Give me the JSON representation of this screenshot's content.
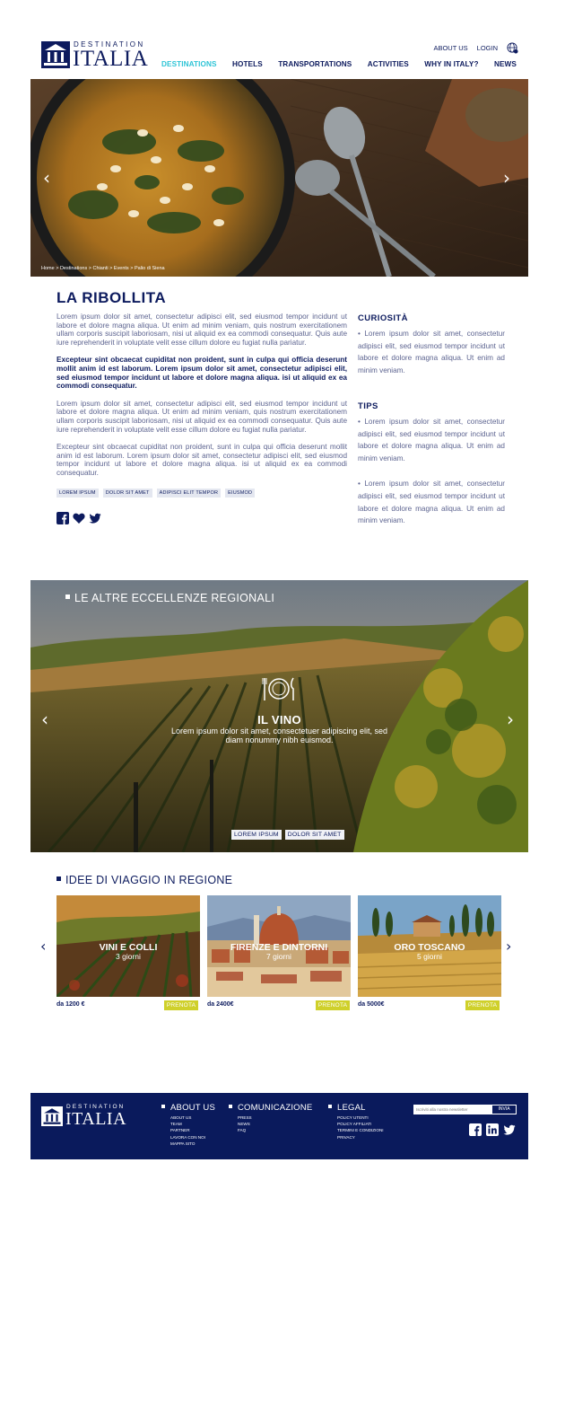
{
  "brand": {
    "logo_top": "DESTINATION",
    "logo_main": "ITALIA"
  },
  "util_nav": {
    "about": "ABOUT US",
    "login": "LOGIN"
  },
  "main_nav": [
    "DESTINATIONS",
    "HOTELS",
    "TRANSPORTATIONS",
    "ACTIVITIES",
    "WHY IN ITALY?",
    "NEWS"
  ],
  "hero": {
    "breadcrumb": "Home > Destinations > Chianti > Events > Palio di Siena"
  },
  "article": {
    "title": "LA RIBOLLITA",
    "paragraphs": [
      "Lorem ipsum dolor sit amet, consectetur adipisci elit, sed eiusmod tempor incidunt ut labore et dolore magna aliqua. Ut enim ad minim veniam, quis nostrum exercitationem ullam corporis suscipit laboriosam, nisi ut aliquid ex ea commodi consequatur. Quis aute iure reprehenderit in voluptate velit esse cillum dolore eu fugiat nulla pariatur.",
      "Excepteur sint obcaecat cupiditat non proident, sunt in culpa qui officia deserunt mollit anim id est laborum. Lorem ipsum dolor sit amet, consectetur adipisci elit, sed eiusmod tempor incidunt ut labore et dolore magna aliqua. isi ut aliquid ex ea commodi consequatur.",
      "Lorem ipsum dolor sit amet, consectetur adipisci elit, sed eiusmod tempor incidunt ut labore et dolore magna aliqua. Ut enim ad minim veniam, quis nostrum exercitationem ullam corporis suscipit laboriosam, nisi ut aliquid ex ea commodi consequatur. Quis aute iure reprehenderit in voluptate velit esse cillum dolore eu fugiat nulla pariatur.",
      "Excepteur sint obcaecat cupiditat non proident, sunt in culpa qui officia deserunt mollit anim id est laborum. Lorem ipsum dolor sit amet, consectetur adipisci elit, sed eiusmod tempor incidunt ut labore et dolore magna aliqua. isi ut aliquid ex ea commodi consequatur."
    ],
    "tags": [
      "LOREM IPSUM",
      "DOLOR SIT AMET",
      "ADIPISCI ELIT TEMPOR",
      "EIUSMOD"
    ]
  },
  "sidebar": {
    "curiosita_title": "CURIOSITÀ",
    "curiosita_text": "• Lorem ipsum dolor sit amet, consectetur adipisci elit, sed eiusmod tempor incidunt ut labore et dolore magna aliqua. Ut enim ad minim veniam.",
    "tips_title": "TIPS",
    "tips": [
      "• Lorem ipsum dolor sit amet, consectetur adipisci elit, sed eiusmod tempor incidunt ut labore et dolore magna aliqua. Ut enim ad minim veniam.",
      "• Lorem ipsum dolor sit amet, consectetur adipisci elit, sed eiusmod tempor incidunt ut labore et dolore magna aliqua. Ut enim ad minim veniam."
    ]
  },
  "regional": {
    "title": "LE ALTRE ECCELLENZE REGIONALI",
    "item_title": "IL VINO",
    "item_text": "Lorem ipsum dolor sit amet, consectetuer adipiscing elit, sed diam nonummy nibh euismod.",
    "tags": [
      "LOREM IPSUM",
      "DOLOR SIT AMET"
    ]
  },
  "ideas": {
    "title": "IDEE DI VIAGGIO IN REGIONE",
    "cards": [
      {
        "name": "VINI E COLLI",
        "days": "3 giorni",
        "price": "da 1200 €",
        "cta": "PRENOTA"
      },
      {
        "name": "FIRENZE E DINTORNI",
        "days": "7 giorni",
        "price": "da 2400€",
        "cta": "PRENOTA"
      },
      {
        "name": "ORO TOSCANO",
        "days": "5 giorni",
        "price": "da 5000€",
        "cta": "PRENOTA"
      }
    ]
  },
  "footer": {
    "cols": [
      {
        "title": "ABOUT US",
        "items": [
          "ABOUT US",
          "TEAM",
          "PARTNER",
          "LAVORA CON NOI",
          "MAPPA SITO"
        ]
      },
      {
        "title": "COMUNICAZIONE",
        "items": [
          "PRESS",
          "NEWS",
          "FAQ"
        ]
      },
      {
        "title": "LEGAL",
        "items": [
          "POLICY UTENTI",
          "POLICY AFFILIATI",
          "TERMINI E CONDIZIONI",
          "PRIVACY"
        ]
      }
    ],
    "newsletter_placeholder": "Iscriviti alla nostra newsletter",
    "newsletter_button": "INVIA"
  },
  "colors": {
    "navy": "#0d1b5e",
    "accent_cyan": "#2ec4d6",
    "cta_yellow": "#cfd02a",
    "footer_bg": "#0a1a5c"
  }
}
